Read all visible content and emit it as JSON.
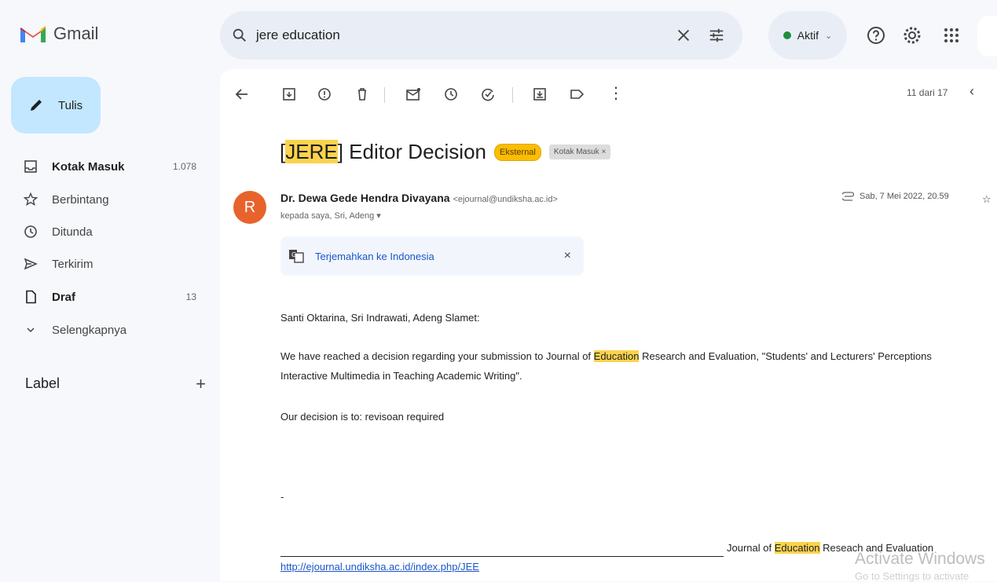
{
  "app": {
    "name": "Gmail"
  },
  "search": {
    "query": "jere education"
  },
  "status": {
    "label": "Aktif"
  },
  "compose": {
    "label": "Tulis"
  },
  "sidebar": {
    "items": [
      {
        "label": "Kotak Masuk",
        "count": "1.078"
      },
      {
        "label": "Berbintang",
        "count": ""
      },
      {
        "label": "Ditunda",
        "count": ""
      },
      {
        "label": "Terkirim",
        "count": ""
      },
      {
        "label": "Draf",
        "count": "13"
      },
      {
        "label": "Selengkapnya",
        "count": ""
      }
    ],
    "label_header": "Label",
    "label_add": "+"
  },
  "toolbar": {
    "counter": "11 dari 17",
    "more": "⋮"
  },
  "email": {
    "subject_prefix": "[",
    "subject_highlight": "JERE",
    "subject_rest": "] Editor Decision",
    "chip_external": "Eksternal",
    "chip_label": "Kotak Masuk ×",
    "avatar_letter": "R",
    "sender_name": "Dr. Dewa Gede Hendra Divayana",
    "sender_email": "<ejournal@undiksha.ac.id>",
    "recipients": "kepada saya, Sri, Adeng ▾",
    "date": "Sab, 7 Mei 2022, 20.59",
    "edge_char": "☆"
  },
  "translate": {
    "label": "Terjemahkan ke Indonesia",
    "close": "×"
  },
  "body": {
    "greeting": "Santi Oktarina, Sri Indrawati, Adeng Slamet:",
    "p1_a": "We have reached a decision regarding your submission to Journal of ",
    "p1_hl": "Education",
    "p1_b": " Research and Evaluation, \"Students' and Lecturers' Perceptions",
    "p1_line2": "Interactive Multimedia in Teaching Academic Writing\".",
    "decision": "Our decision is to: revisoan required",
    "dash": "-",
    "sig_a": "Journal of ",
    "sig_hl": "Education",
    "sig_b": " Reseach and Evaluation",
    "link": "http://ejournal.undiksha.ac.id/index.php/JEE"
  },
  "watermark": {
    "line1": "Activate Windows",
    "line2": "Go to Settings to activate"
  }
}
